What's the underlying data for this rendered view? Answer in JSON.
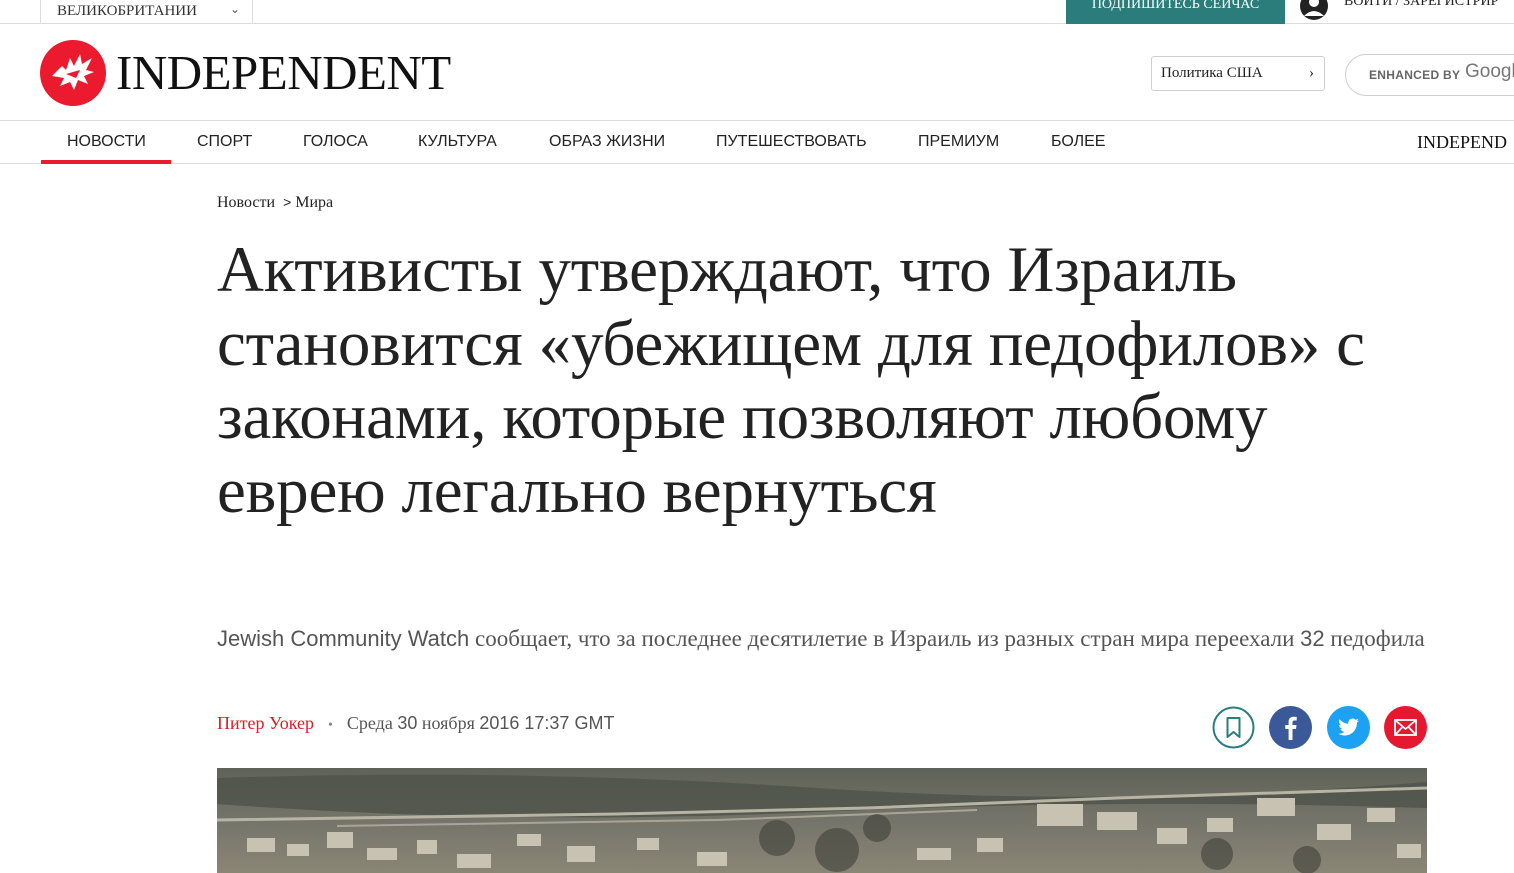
{
  "topbar": {
    "region_label": "ВЕЛИКОБРИТАНИИ",
    "subscribe_label": "ПОДПИШИТЕСЬ СЕЙЧАС",
    "login_label": "ВОЙТИ / ЗАРЕГИСТРИР"
  },
  "header": {
    "logo_text": "INDEPENDENT",
    "edition_label": "Политика США",
    "search_enhanced": "ENHANCED BY",
    "search_google": "Googl"
  },
  "nav": {
    "items": [
      "НОВОСТИ",
      "СПОРТ",
      "ГОЛОСА",
      "КУЛЬТУРА",
      "ОБРАЗ ЖИЗНИ",
      "ПУТЕШЕСТВОВАТЬ",
      "ПРЕМИУМ",
      "БОЛЕЕ"
    ],
    "active_index": 0,
    "brand_text": "INDEPEND"
  },
  "article": {
    "breadcrumb": [
      "Новости",
      "Мира"
    ],
    "breadcrumb_separator": ">",
    "headline": "Активисты утверждают, что Израиль становится «убежищем для педофилов» с законами, которые позволяют любому еврею легально вернуться",
    "standfirst_org": "Jewish Community Watch",
    "standfirst_text_1": " сообщает, что за последнее десятилетие в Израиль из разных стран мира переехали ",
    "standfirst_number": "32",
    "standfirst_text_2": " педофила",
    "author": "Питер Уокер",
    "byline_separator": "•",
    "date_weekday": "Среда ",
    "date_day": "30",
    "date_month": " ноября ",
    "date_rest": "2016 17:37 GMT"
  },
  "share": {
    "icons": [
      "bookmark-icon",
      "facebook-icon",
      "twitter-icon",
      "email-icon"
    ]
  },
  "colors": {
    "brand_red": "#ec1a2e",
    "subscribe_bg": "#2a7d7a",
    "author_red": "#d61f26",
    "bookmark_teal": "#2a7d7a",
    "facebook": "#3b5998",
    "twitter": "#1da1f2",
    "email_red": "#e5182f"
  }
}
